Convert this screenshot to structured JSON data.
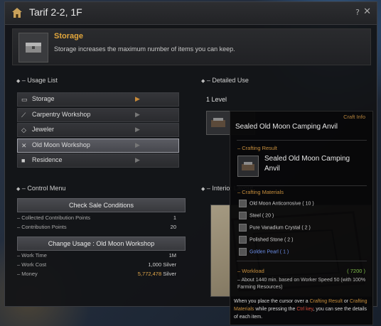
{
  "window": {
    "title": "Tarif 2-2, 1F",
    "help": "?",
    "close": "✕"
  },
  "info": {
    "title": "Storage",
    "desc": "Storage increases the maximum number of items you can keep."
  },
  "usage": {
    "header": "– Usage List",
    "items": [
      {
        "label": "Storage",
        "icon": "storage-icon",
        "glyph": "▭",
        "arrow_hi": true
      },
      {
        "label": "Carpentry Workshop",
        "icon": "saw-icon",
        "glyph": "⟋",
        "arrow_hi": false
      },
      {
        "label": "Jeweler",
        "icon": "gem-icon",
        "glyph": "◇",
        "arrow_hi": false
      },
      {
        "label": "Old Moon Workshop",
        "icon": "tools-icon",
        "glyph": "✕",
        "arrow_hi": false,
        "selected": true
      },
      {
        "label": "Residence",
        "icon": "residence-icon",
        "glyph": "■",
        "arrow_hi": false
      }
    ]
  },
  "control": {
    "header": "– Control Menu",
    "check_btn": "Check Sale Conditions",
    "collected_label": "– Collected Contribution Points",
    "collected_val": "1",
    "contrib_label": "– Contribution Points",
    "contrib_val": "20",
    "change_btn": "Change Usage : Old Moon Workshop",
    "work_time_label": "– Work Time",
    "work_time_val": "1M",
    "work_cost_label": "– Work Cost",
    "work_cost_val": "1,000",
    "work_cost_unit": "Silver",
    "money_label": "– Money",
    "money_val": "5,772,478",
    "money_unit": "Silver"
  },
  "detail": {
    "header": "– Detailed Use",
    "level": "1 Level",
    "interior_header": "– Interior Layout"
  },
  "tooltip": {
    "craft_info": "Craft Info",
    "name": "Sealed Old Moon Camping Anvil",
    "result_header": "– Crafting Result",
    "result_name": "Sealed Old Moon Camping Anvil",
    "materials_header": "– Crafting Materials",
    "materials": [
      {
        "text": "Old Moon Anticorrosive ( 10 )",
        "blue": false
      },
      {
        "text": "Steel ( 20 )",
        "blue": false
      },
      {
        "text": "Pure Vanadium Crystal ( 2 )",
        "blue": false
      },
      {
        "text": "Polished Stone ( 2 )",
        "blue": false
      },
      {
        "text": "Golden Pearl ( 1 )",
        "blue": true
      }
    ],
    "workload_header": "– Workload",
    "workload_val": "( 7200 )",
    "workload_desc": "– About 1440 min. based on Worker Speed 50 (with 100% Farming Resources)",
    "hint_1": "When you place the cursor over a ",
    "hint_o1": "Crafting Result",
    "hint_2": " or ",
    "hint_o2": "Crafting Materials",
    "hint_3": " while pressing the ",
    "hint_r": "Ctrl key",
    "hint_4": ", you can see the details of each item."
  }
}
